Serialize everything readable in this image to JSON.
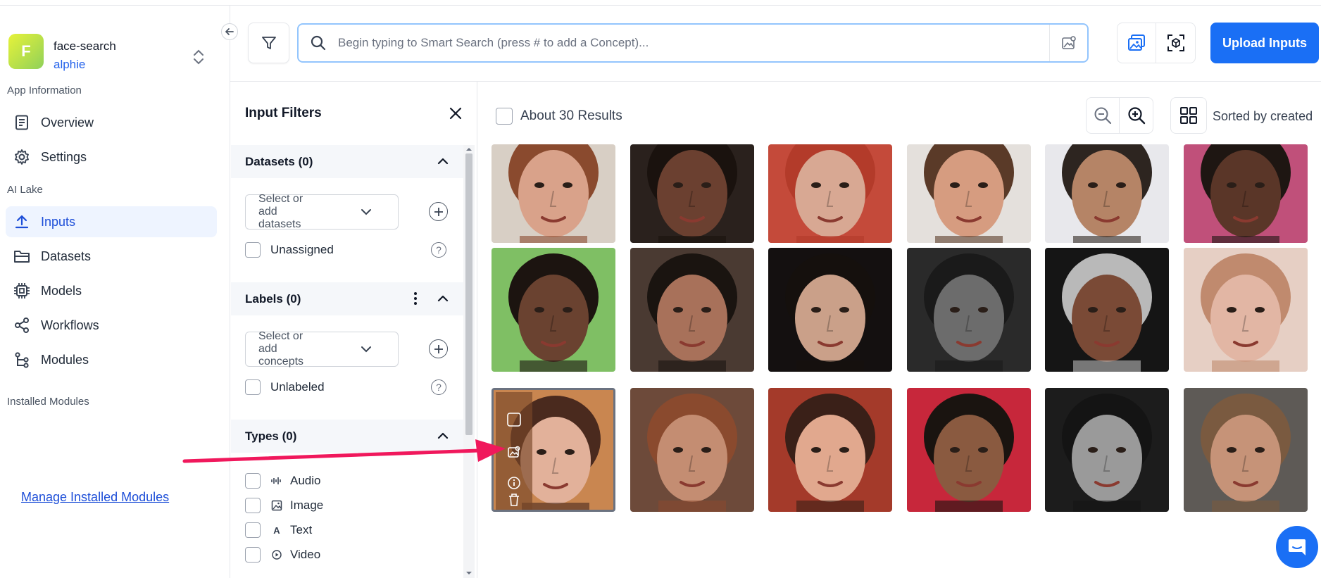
{
  "app": {
    "avatar_letter": "F",
    "name": "face-search",
    "user": "alphie"
  },
  "sidebar": {
    "section_app_info": "App Information",
    "overview": "Overview",
    "settings": "Settings",
    "section_ai_lake": "AI Lake",
    "inputs": "Inputs",
    "datasets": "Datasets",
    "models": "Models",
    "workflows": "Workflows",
    "modules": "Modules",
    "section_installed": "Installed Modules",
    "manage_link": "Manage Installed Modules"
  },
  "header": {
    "search_placeholder": "Begin typing to Smart Search (press # to add a Concept)...",
    "upload_label": "Upload Inputs"
  },
  "filters": {
    "title": "Input Filters",
    "datasets_head": "Datasets (0)",
    "datasets_placeholder": "Select or add datasets",
    "unassigned": "Unassigned",
    "labels_head": "Labels (0)",
    "concepts_placeholder": "Select or add concepts",
    "unlabeled": "Unlabeled",
    "types_head": "Types (0)",
    "types": [
      {
        "label": "Audio",
        "icon": "audio-icon"
      },
      {
        "label": "Image",
        "icon": "image-icon"
      },
      {
        "label": "Text",
        "icon": "text-icon"
      },
      {
        "label": "Video",
        "icon": "video-icon"
      }
    ]
  },
  "results": {
    "count_label": "About 30 Results",
    "sort_label": "Sorted by created"
  },
  "colors": {
    "accent": "#1a6ff5",
    "arrow": "#f0185c",
    "active_nav_bg": "#eef4ff"
  },
  "grid_items": [
    {
      "name": "face-tile-1",
      "bg": "#d8cfc5",
      "skin": "#d9a28a",
      "hair": "#8a4a2e"
    },
    {
      "name": "face-tile-2",
      "bg": "#2a211d",
      "skin": "#6b4030",
      "hair": "#1a120e"
    },
    {
      "name": "face-tile-3",
      "bg": "#c44a3a",
      "skin": "#d8a893",
      "hair": "#b33b2a"
    },
    {
      "name": "face-tile-4",
      "bg": "#e4e0dc",
      "skin": "#d69c80",
      "hair": "#5a3a28"
    },
    {
      "name": "face-tile-5",
      "bg": "#e8e8ec",
      "skin": "#b58466",
      "hair": "#2d2520"
    },
    {
      "name": "face-tile-6",
      "bg": "#c0507a",
      "skin": "#5a3628",
      "hair": "#1e1612"
    },
    {
      "name": "face-tile-7",
      "bg": "#7fbf64",
      "skin": "#6a4230",
      "hair": "#1c1410"
    },
    {
      "name": "face-tile-8",
      "bg": "#4a3a32",
      "skin": "#a8715a",
      "hair": "#1a1410"
    },
    {
      "name": "face-tile-9",
      "bg": "#141010",
      "skin": "#caa089",
      "hair": "#15100d"
    },
    {
      "name": "face-tile-10",
      "bg": "#2a2a2a",
      "skin": "#6c6c6c",
      "hair": "#1a1a1a"
    },
    {
      "name": "face-tile-11",
      "bg": "#151515",
      "skin": "#7a4a36",
      "hair": "#b9b9b9"
    },
    {
      "name": "face-tile-12",
      "bg": "#e6cfc4",
      "skin": "#e2b6a4",
      "hair": "#c08a6e"
    },
    {
      "name": "face-tile-13",
      "bg": "#c98650",
      "skin": "#e2b19a",
      "hair": "#4a2a1e"
    },
    {
      "name": "face-tile-14",
      "bg": "#6d4a3a",
      "skin": "#c48d72",
      "hair": "#8a4a2e"
    },
    {
      "name": "face-tile-15",
      "bg": "#a43a2a",
      "skin": "#e1a88e",
      "hair": "#3a2018"
    },
    {
      "name": "face-tile-16",
      "bg": "#c7273b",
      "skin": "#8a5a40",
      "hair": "#1a1410"
    },
    {
      "name": "face-tile-17",
      "bg": "#1c1c1c",
      "skin": "#9a9a9a",
      "hair": "#141414"
    },
    {
      "name": "face-tile-18",
      "bg": "#5e5a56",
      "skin": "#c69378",
      "hair": "#7a5a40"
    }
  ]
}
